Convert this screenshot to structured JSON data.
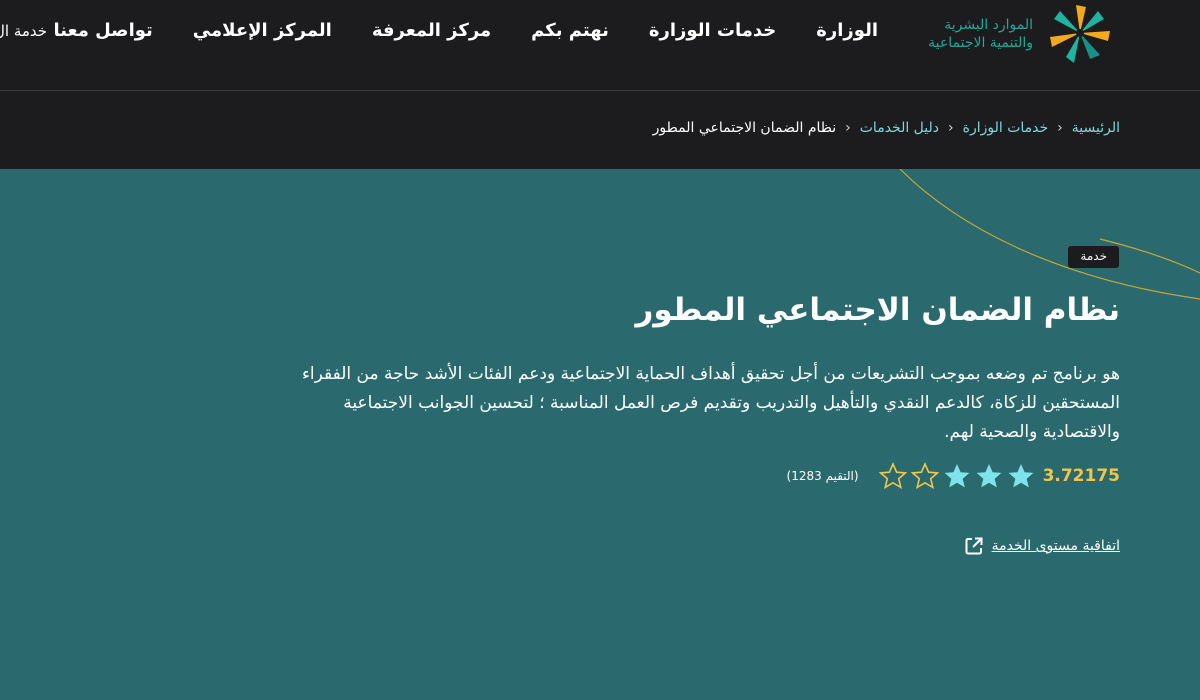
{
  "header": {
    "logo": {
      "line1": "الموارد البشرية",
      "line2": "والتنمية الاجتماعية"
    },
    "nav": [
      "الوزارة",
      "خدمات الوزارة",
      "نهتم بكم",
      "مركز المعرفة",
      "المركز الإعلامي",
      "تواصل معنا"
    ],
    "nav_cut": "خدمة ال"
  },
  "breadcrumb": {
    "items": [
      "الرئيسية",
      "خدمات الوزارة",
      "دليل الخدمات"
    ],
    "current": "نظام الضمان الاجتماعي المطور"
  },
  "service": {
    "tag": "خدمة",
    "title": "نظام الضمان الاجتماعي المطور",
    "description": "هو برنامج تم وضعه بموجب التشريعات من أجل تحقيق أهداف الحماية الاجتماعية ودعم الفئات الأشد حاجة من الفقراء المستحقين للزكاة، كالدعم النقدي والتأهيل والتدريب وتقديم فرص العمل المناسبة ؛ لتحسين الجوانب الاجتماعية والاقتصادية والصحية لهم.",
    "rating": {
      "value": "3.72175",
      "filled_stars": 3,
      "total_stars": 5,
      "count_label": "(التقيم 1283)"
    },
    "sla_link": "اتفاقية مستوى الخدمة"
  },
  "colors": {
    "header_bg": "#1c1c1e",
    "content_bg": "#2a6a6e",
    "accent_link": "#7fd6dc",
    "star_filled": "#7fe3ec",
    "star_outline": "#f0c64a",
    "rating_value": "#f0c64a"
  },
  "icons": {
    "star": "star-icon",
    "external_link": "external-link-icon",
    "chevron": "chevron-left-icon"
  }
}
